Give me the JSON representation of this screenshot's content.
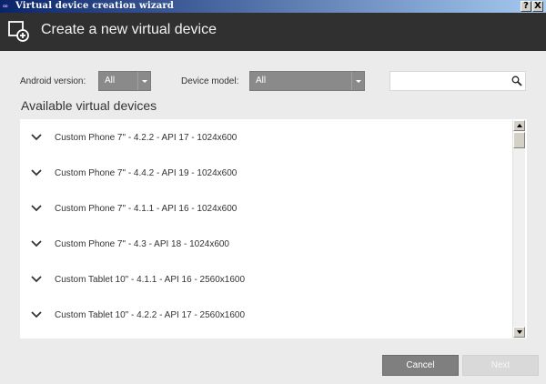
{
  "window": {
    "title": "Virtual device creation wizard",
    "help_label": "?",
    "close_label": "X"
  },
  "header": {
    "title": "Create a new virtual device"
  },
  "filters": {
    "android_version_label": "Android version:",
    "android_version_value": "All",
    "device_model_label": "Device model:",
    "device_model_value": "All",
    "search_placeholder": ""
  },
  "list": {
    "title": "Available virtual devices",
    "items": [
      {
        "label": "Custom Phone 7\" - 4.2.2 - API 17 - 1024x600"
      },
      {
        "label": "Custom Phone 7\" - 4.4.2 - API 19 - 1024x600"
      },
      {
        "label": "Custom Phone 7\" - 4.1.1 - API 16 - 1024x600"
      },
      {
        "label": "Custom Phone 7\" - 4.3 - API 18 - 1024x600"
      },
      {
        "label": "Custom Tablet 10\" - 4.1.1 - API 16 - 2560x1600"
      },
      {
        "label": "Custom Tablet 10\" - 4.2.2 - API 17 - 2560x1600"
      }
    ]
  },
  "footer": {
    "cancel_label": "Cancel",
    "next_label": "Next"
  },
  "colors": {
    "header_bg": "#303030",
    "dropdown_bg": "#8a8a8a",
    "cancel_bg": "#7f7f7f",
    "next_disabled_bg": "#d9d9d9"
  },
  "icons": {
    "header": "add-device-icon",
    "search": "search-icon",
    "row_toggle": "chevron-down-icon"
  }
}
